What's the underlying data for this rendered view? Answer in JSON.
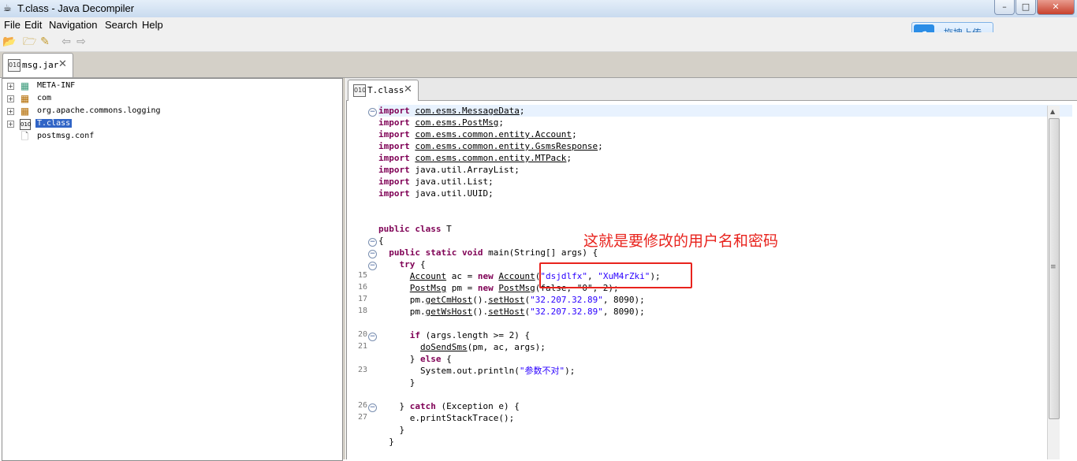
{
  "window": {
    "title": "T.class - Java Decompiler",
    "minimize_label": "–",
    "maximize_label": "□",
    "close_label": "✕"
  },
  "menu": [
    "File",
    "Edit",
    "Navigation",
    "Search",
    "Help"
  ],
  "toolbar_icons": [
    "open-folder-icon",
    "open-type-icon",
    "hierarchy-icon",
    "back-icon",
    "forward-icon"
  ],
  "upload_widget": {
    "label": "拖拽上传",
    "icon": "baidu-cloud-icon"
  },
  "top_tab": {
    "label": "msg.jar",
    "close": "✕"
  },
  "tree": [
    {
      "label": "META-INF",
      "icon": "package-icon",
      "expander": "+"
    },
    {
      "label": "com",
      "icon": "package-icon",
      "expander": "+"
    },
    {
      "label": "org.apache.commons.logging",
      "icon": "package-icon",
      "expander": "+"
    },
    {
      "label": "T.class",
      "icon": "class-file-icon",
      "expander": "+",
      "selected": true
    },
    {
      "label": "postmsg.conf",
      "icon": "file-icon",
      "expander": ""
    }
  ],
  "editor_tab": {
    "label": "T.class",
    "close": "✕"
  },
  "code": {
    "imports": [
      {
        "kw": "import",
        "path": "com.esms.MessageData",
        "linked": true
      },
      {
        "kw": "import",
        "path": "com.esms.PostMsg",
        "linked": true
      },
      {
        "kw": "import",
        "path": "com.esms.common.entity.Account",
        "linked": true
      },
      {
        "kw": "import",
        "path": "com.esms.common.entity.GsmsResponse",
        "linked": true
      },
      {
        "kw": "import",
        "path": "com.esms.common.entity.MTPack",
        "linked": true
      },
      {
        "kw": "import",
        "path": "java.util.ArrayList",
        "linked": false
      },
      {
        "kw": "import",
        "path": "java.util.List",
        "linked": false
      },
      {
        "kw": "import",
        "path": "java.util.UUID",
        "linked": false
      }
    ],
    "class_decl": {
      "kw1": "public",
      "kw2": "class",
      "name": "T"
    },
    "open_brace": "{",
    "main_decl": {
      "kw1": "public",
      "kw2": "static",
      "kw3": "void",
      "rest": "main(String[] args) {"
    },
    "try_kw": "try",
    "try_rest": " {",
    "line15": {
      "type": "Account",
      "mid": " ac = ",
      "kw": "new",
      "ctor": "Account",
      "open": "(",
      "user": "\"dsjdlfx\"",
      "sep": ", ",
      "pass": "\"XuM4rZki\"",
      "close": ");"
    },
    "line16": {
      "type": "PostMsg",
      "mid": " pm = ",
      "kw": "new",
      "ctor": "PostMsg",
      "args": "(false, \"0\", 2);"
    },
    "line17": {
      "pre": "pm.",
      "m1": "getCmHost",
      "mid": "().",
      "m2": "setHost",
      "open": "(",
      "host": "\"32.207.32.89\"",
      "rest": ", 8090);"
    },
    "line18": {
      "pre": "pm.",
      "m1": "getWsHost",
      "mid": "().",
      "m2": "setHost",
      "open": "(",
      "host": "\"32.207.32.89\"",
      "rest": ", 8090);"
    },
    "line20": {
      "kw": "if",
      "rest": " (args.length >= 2) {"
    },
    "line21": {
      "method": "doSendSms",
      "rest": "(pm, ac, args);"
    },
    "line22": {
      "pre": "} ",
      "kw": "else",
      "rest": " {"
    },
    "line23": {
      "pre": "System.out.println(",
      "str": "\"参数不对\"",
      "rest": ");"
    },
    "close_if": "}",
    "line26": {
      "pre": "} ",
      "kw": "catch",
      "rest": " (Exception e) {"
    },
    "line27": "e.printStackTrace();",
    "close_catch": "}",
    "close_main": "}"
  },
  "line_numbers": {
    "l15": "15",
    "l16": "16",
    "l17": "17",
    "l18": "18",
    "l20": "20",
    "l21": "21",
    "l23": "23",
    "l26": "26",
    "l27": "27"
  },
  "annotation": {
    "text": "这就是要修改的用户名和密码",
    "color": "#e8231d"
  },
  "colors": {
    "keyword": "#7f0055",
    "string": "#2a00ff",
    "selection": "#3165c6"
  }
}
